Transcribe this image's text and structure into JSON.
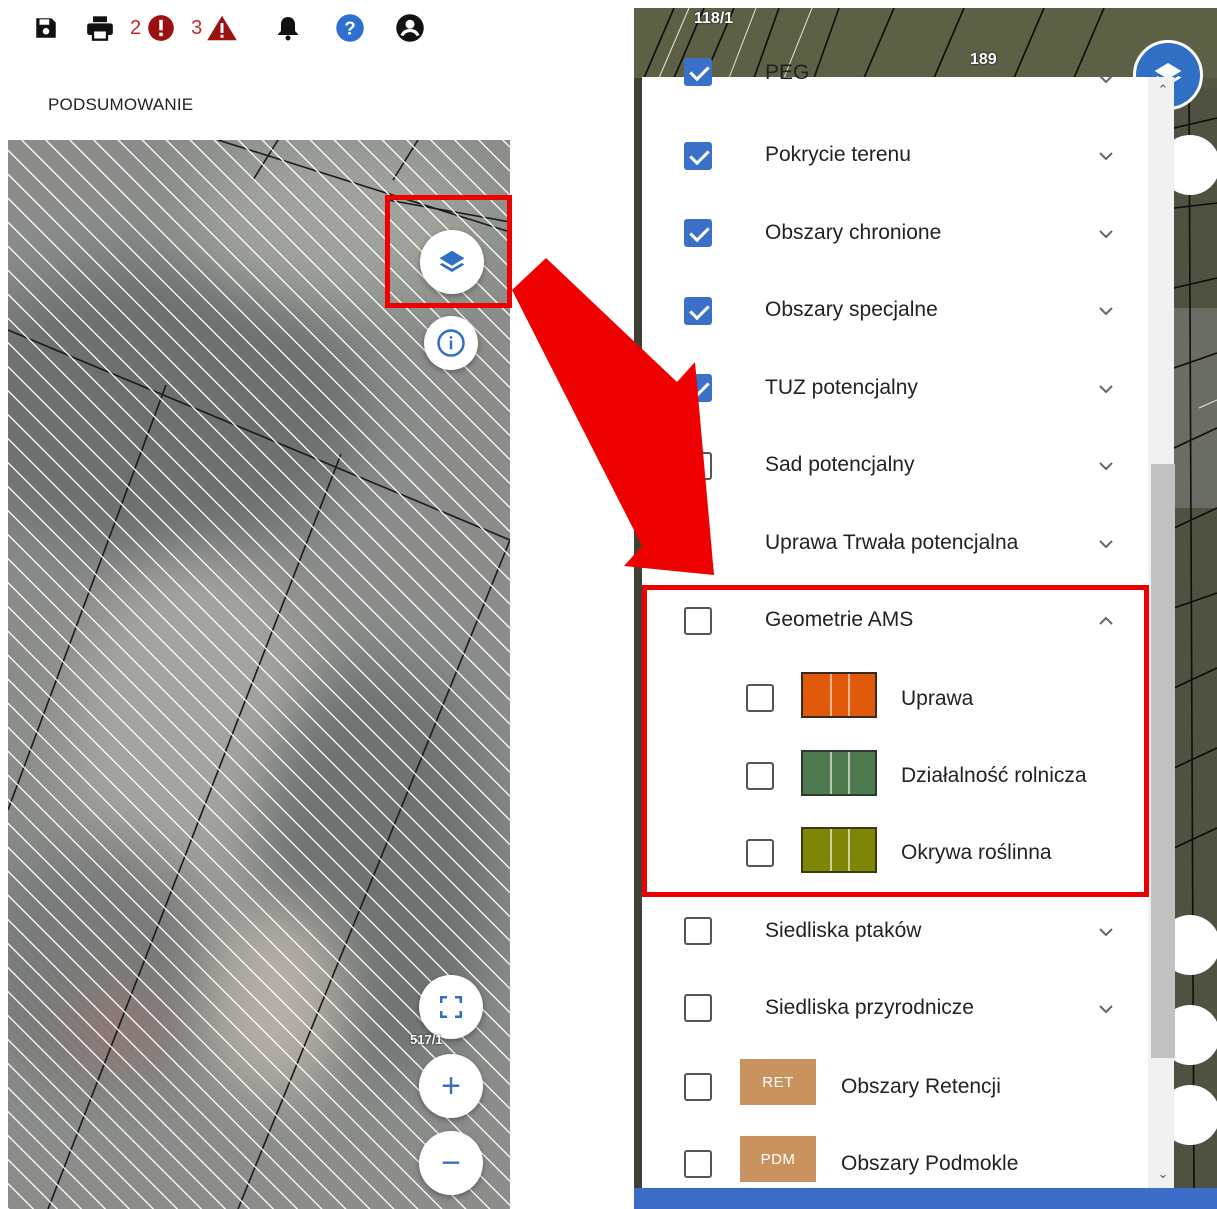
{
  "toolbar": {
    "save_icon": "save-icon",
    "print_icon": "print-icon",
    "errors_count": "2",
    "warnings_count": "3",
    "bell_icon": "bell-icon",
    "help_icon": "help-icon",
    "account_icon": "account-icon"
  },
  "page": {
    "title": "PODSUMOWANIE"
  },
  "left_map": {
    "parcel_label": "517/1",
    "buttons": {
      "layers": "layers-icon",
      "info": "info-icon",
      "fullscreen": "fullscreen-icon",
      "zoom_in": "+",
      "zoom_out": "−"
    }
  },
  "right_map": {
    "parcel_labels": [
      "118/1",
      "189"
    ]
  },
  "layers": {
    "partial_top_label": "PEG",
    "items": [
      {
        "label": "Pokrycie terenu",
        "checked": true
      },
      {
        "label": "Obszary chronione",
        "checked": true
      },
      {
        "label": "Obszary specjalne",
        "checked": true
      },
      {
        "label": "TUZ potencjalny",
        "checked": true
      },
      {
        "label": "Sad potencjalny",
        "checked": false
      },
      {
        "label": "Uprawa Trwała potencjalna",
        "checked": null
      },
      {
        "label": "Geometrie AMS",
        "checked": false,
        "expanded": true
      },
      {
        "label": "Siedliska ptaków",
        "checked": false
      },
      {
        "label": "Siedliska przyrodnicze",
        "checked": false
      }
    ],
    "ams_sublayers": [
      {
        "label": "Uprawa",
        "color": "#e05a0a"
      },
      {
        "label": "Działalność rolnicza",
        "color": "#4f7a4f"
      },
      {
        "label": "Okrywa roślinna",
        "color": "#7f8506"
      }
    ],
    "tagged_items": [
      {
        "tag": "RET",
        "label": "Obszary Retencji"
      },
      {
        "tag": "PDM",
        "label": "Obszary Podmokle"
      }
    ]
  },
  "colors": {
    "accent_blue": "#3a70c8",
    "highlight_red": "#ee0000",
    "tag_brown": "#c9935f"
  }
}
